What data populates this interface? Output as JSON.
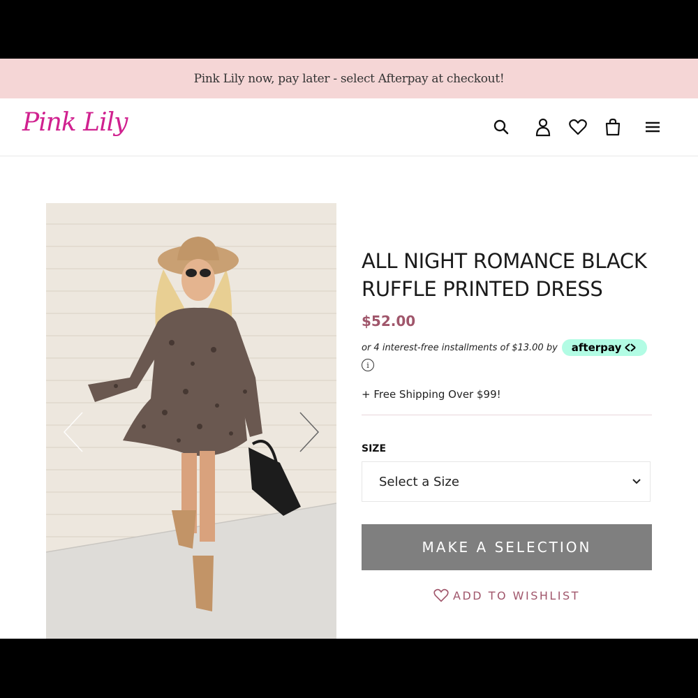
{
  "promo": {
    "text": "Pink Lily now, pay later - select Afterpay at checkout!"
  },
  "header": {
    "logo": "Pink Lily",
    "icons": [
      "search-icon",
      "account-icon",
      "heart-icon",
      "bag-icon",
      "menu-icon"
    ]
  },
  "gallery": {
    "prev_icon": "chevron-left-icon",
    "next_icon": "chevron-right-icon"
  },
  "product": {
    "title": "ALL NIGHT ROMANCE BLACK RUFFLE PRINTED DRESS",
    "price": "$52.00",
    "installments_text": "or 4 interest-free installments of $13.00 by",
    "afterpay_label": "afterpay",
    "info_glyph": "i",
    "shipping": "+ Free Shipping Over $99!",
    "size_label": "SIZE",
    "size_select_value": "Select a Size",
    "primary_button": "MAKE A SELECTION",
    "wishlist_label": "ADD TO WISHLIST"
  },
  "colors": {
    "promo_bg": "#f5d6d6",
    "brand_pink": "#d0218f",
    "price": "#a0566b",
    "afterpay_mint": "#b2fce4",
    "button_gray": "#7f7f7f"
  }
}
